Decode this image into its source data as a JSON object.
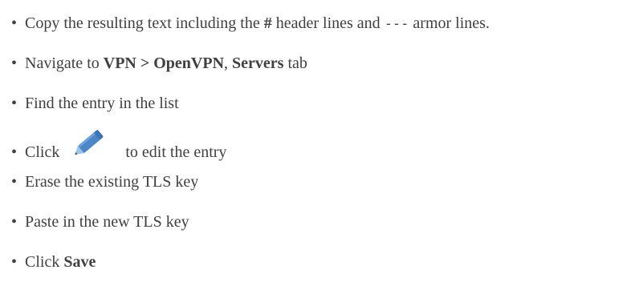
{
  "bullet_char": "•",
  "items": [
    {
      "parts": [
        "Copy the resulting text including the ",
        "#",
        " header lines and ",
        "---",
        " armor lines."
      ]
    },
    {
      "parts": [
        "Navigate to ",
        "VPN > OpenVPN",
        ", ",
        "Servers",
        " tab"
      ]
    },
    {
      "parts": [
        "Find the entry in the list"
      ]
    },
    {
      "parts": [
        "Click",
        "to edit the entry"
      ],
      "icon": "pencil-icon",
      "icon_color": "#4a86c8"
    },
    {
      "parts": [
        "Erase the existing TLS key"
      ]
    },
    {
      "parts": [
        "Paste in the new TLS key"
      ]
    },
    {
      "parts": [
        "Click ",
        "Save"
      ]
    }
  ]
}
